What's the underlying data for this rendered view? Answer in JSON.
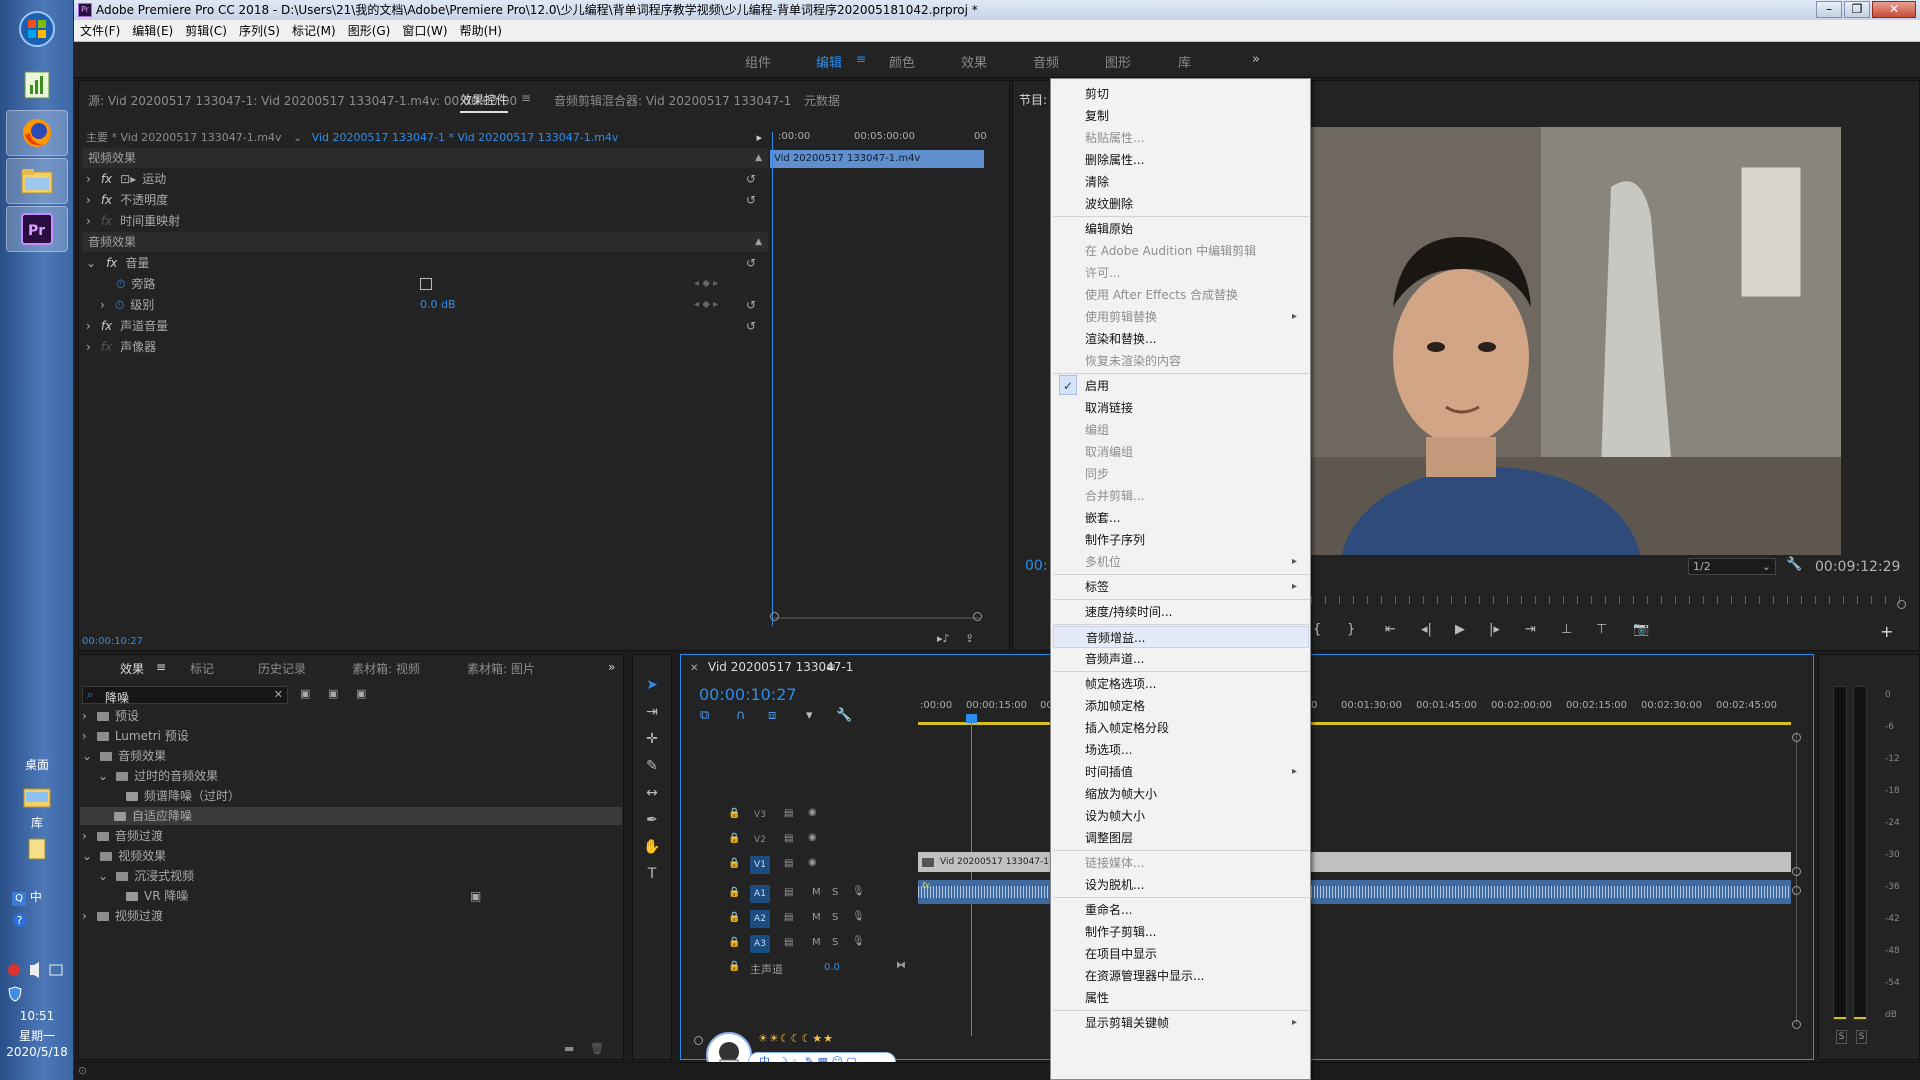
{
  "window": {
    "title": "Adobe Premiere Pro CC 2018 - D:\\Users\\21\\我的文档\\Adobe\\Premiere Pro\\12.0\\少儿编程\\背单词程序教学视频\\少儿编程-背单词程序202005181042.prproj *"
  },
  "menu": [
    "文件(F)",
    "编辑(E)",
    "剪辑(C)",
    "序列(S)",
    "标记(M)",
    "图形(G)",
    "窗口(W)",
    "帮助(H)"
  ],
  "workspaces": [
    "组件",
    "编辑",
    "颜色",
    "效果",
    "音频",
    "图形",
    "库"
  ],
  "workspace_more": "»",
  "source_tabs": {
    "source": "源: Vid 20200517 133047-1: Vid 20200517 133047-1.m4v: 00:00:00:00",
    "effect_controls": "效果控件",
    "audio_mixer": "音频剪辑混合器: Vid 20200517 133047-1",
    "metadata": "元数据"
  },
  "effect_controls": {
    "master_clip": "主要 * Vid 20200517 133047-1.m4v",
    "sequence_clip": "Vid 20200517 133047-1 * Vid 20200517 133047-1.m4v",
    "ruler_start": ":00:00",
    "ruler_mid": "00:05:00:00",
    "ruler_end": "00",
    "clip_bar": "Vid 20200517 133047-1.m4v",
    "video_effects": "视频效果",
    "motion": "运动",
    "opacity": "不透明度",
    "time_remap": "时间重映射",
    "audio_effects": "音频效果",
    "volume": "音量",
    "bypass": "旁路",
    "level": "级别",
    "level_value": "0.0 dB",
    "channel_volume": "声道音量",
    "panner": "声像器",
    "timecode": "00:00:10:27"
  },
  "program": {
    "label": "节目:",
    "timecode_left": "00:",
    "fraction": "1/2",
    "duration": "00:09:12:29"
  },
  "effects_panel": {
    "tabs": [
      "效果",
      "标记",
      "历史记录",
      "素材箱: 视频",
      "素材箱: 图片"
    ],
    "more": "»",
    "search": "降噪",
    "tree": [
      {
        "label": "预设",
        "depth": 0,
        "type": "folder",
        "expanded": false
      },
      {
        "label": "Lumetri 预设",
        "depth": 0,
        "type": "folder",
        "expanded": false
      },
      {
        "label": "音频效果",
        "depth": 0,
        "type": "folder",
        "expanded": true
      },
      {
        "label": "过时的音频效果",
        "depth": 1,
        "type": "folder",
        "expanded": true
      },
      {
        "label": "频谱降噪（过时）",
        "depth": 2,
        "type": "effect"
      },
      {
        "label": "自适应降噪",
        "depth": 1,
        "type": "effect",
        "selected": true
      },
      {
        "label": "音频过渡",
        "depth": 0,
        "type": "folder",
        "expanded": false
      },
      {
        "label": "视频效果",
        "depth": 0,
        "type": "folder",
        "expanded": true
      },
      {
        "label": "沉浸式视频",
        "depth": 1,
        "type": "folder",
        "expanded": true
      },
      {
        "label": "VR 降噪",
        "depth": 2,
        "type": "effect"
      },
      {
        "label": "视频过渡",
        "depth": 0,
        "type": "folder",
        "expanded": false
      }
    ]
  },
  "timeline": {
    "sequence_name": "Vid 20200517 133047-1",
    "timecode": "00:00:10:27",
    "ruler_left": [
      ":00:00",
      "00:00:15:00",
      "00"
    ],
    "ruler_right": [
      "00:01:30:00",
      "00:01:45:00",
      "00:02:00:00",
      "00:02:15:00",
      "00:02:30:00",
      "00:02:45:00"
    ],
    "video_tracks": [
      "V3",
      "V2",
      "V1"
    ],
    "audio_tracks": [
      "A1",
      "A2",
      "A3"
    ],
    "mute": "M",
    "solo": "S",
    "master": "主声道",
    "master_value": "0.0",
    "clip_name": "Vid 20200517 133047-1.m4v",
    "fx_badge": "fx"
  },
  "audio_meter": {
    "labels": [
      "0",
      "-6",
      "-12",
      "-18",
      "-24",
      "-30",
      "-36",
      "-42",
      "-48",
      "-54",
      "dB"
    ],
    "solo_left": "S",
    "solo_right": "S"
  },
  "context_menu": {
    "items": [
      {
        "label": "剪切",
        "state": "normal"
      },
      {
        "label": "复制",
        "state": "normal"
      },
      {
        "label": "粘贴属性...",
        "state": "disabled"
      },
      {
        "label": "删除属性...",
        "state": "normal"
      },
      {
        "label": "清除",
        "state": "normal"
      },
      {
        "label": "波纹删除",
        "state": "normal"
      },
      {
        "sep": true
      },
      {
        "label": "编辑原始",
        "state": "normal"
      },
      {
        "label": "在 Adobe Audition 中编辑剪辑",
        "state": "disabled"
      },
      {
        "label": "许可...",
        "state": "disabled"
      },
      {
        "label": "使用 After Effects 合成替换",
        "state": "disabled"
      },
      {
        "label": "使用剪辑替换",
        "state": "disabled",
        "submenu": true
      },
      {
        "label": "渲染和替换...",
        "state": "normal"
      },
      {
        "label": "恢复未渲染的内容",
        "state": "disabled"
      },
      {
        "sep": true
      },
      {
        "label": "启用",
        "state": "checked"
      },
      {
        "label": "取消链接",
        "state": "normal"
      },
      {
        "label": "编组",
        "state": "disabled"
      },
      {
        "label": "取消编组",
        "state": "disabled"
      },
      {
        "label": "同步",
        "state": "disabled"
      },
      {
        "label": "合并剪辑...",
        "state": "disabled"
      },
      {
        "label": "嵌套...",
        "state": "normal"
      },
      {
        "label": "制作子序列",
        "state": "normal"
      },
      {
        "label": "多机位",
        "state": "disabled",
        "submenu": true
      },
      {
        "sep": true
      },
      {
        "label": "标签",
        "state": "normal",
        "submenu": true
      },
      {
        "sep": true
      },
      {
        "label": "速度/持续时间...",
        "state": "normal"
      },
      {
        "sep": true
      },
      {
        "label": "音频增益...",
        "state": "highlight"
      },
      {
        "label": "音频声道...",
        "state": "normal"
      },
      {
        "sep": true
      },
      {
        "label": "帧定格选项...",
        "state": "normal"
      },
      {
        "label": "添加帧定格",
        "state": "normal"
      },
      {
        "label": "插入帧定格分段",
        "state": "normal"
      },
      {
        "label": "场选项...",
        "state": "normal"
      },
      {
        "label": "时间插值",
        "state": "normal",
        "submenu": true
      },
      {
        "label": "缩放为帧大小",
        "state": "normal"
      },
      {
        "label": "设为帧大小",
        "state": "normal"
      },
      {
        "label": "调整图层",
        "state": "normal"
      },
      {
        "sep": true
      },
      {
        "label": "链接媒体...",
        "state": "disabled"
      },
      {
        "label": "设为脱机...",
        "state": "normal"
      },
      {
        "sep": true
      },
      {
        "label": "重命名...",
        "state": "normal"
      },
      {
        "label": "制作子剪辑...",
        "state": "normal"
      },
      {
        "label": "在项目中显示",
        "state": "normal"
      },
      {
        "label": "在资源管理器中显示...",
        "state": "normal"
      },
      {
        "label": "属性",
        "state": "normal"
      },
      {
        "sep": true
      },
      {
        "label": "显示剪辑关键帧",
        "state": "normal",
        "submenu": true
      }
    ]
  },
  "taskbar": {
    "desktop": "桌面",
    "library": "库",
    "ime": "中",
    "time": "10:51",
    "weekday": "星期一",
    "date": "2020/5/18"
  },
  "ime_bar": {
    "lang": "中",
    "decor": "☀☀☾☾☾★★"
  },
  "colors": {
    "accent": "#2d8ceb",
    "panel": "#232323",
    "menu_bg": "#f2f2f2",
    "menu_highlight": "#e4eaf7",
    "clip_video": "#c0c0c0",
    "clip_audio": "#3f6aa0"
  }
}
